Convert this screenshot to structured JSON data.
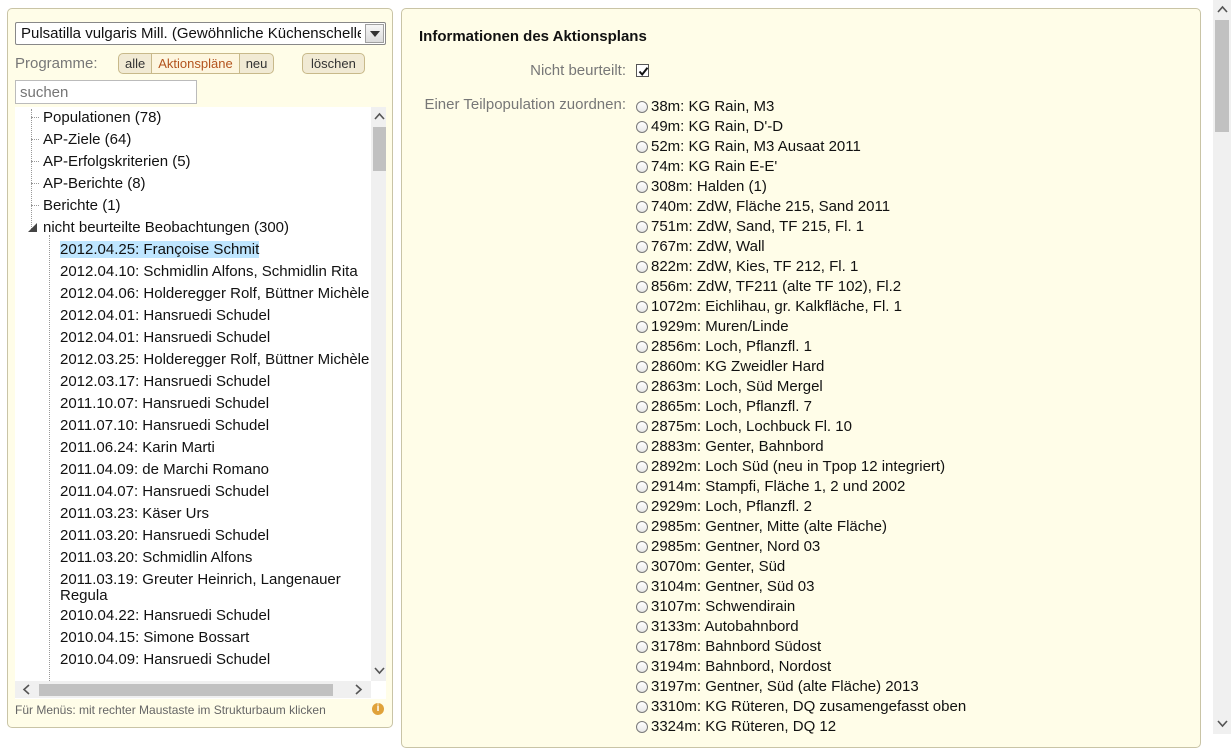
{
  "left": {
    "species_select": "Pulsatilla vulgaris Mill. (Gewöhnliche Küchenschelle)",
    "programme_label": "Programme:",
    "programme_buttons": [
      "alle",
      "Aktionspläne",
      "neu"
    ],
    "active_programme": "Aktionspläne",
    "delete_label": "löschen",
    "search_placeholder": "suchen",
    "tree": {
      "nodes": [
        "Populationen (78)",
        "AP-Ziele (64)",
        "AP-Erfolgskriterien (5)",
        "AP-Berichte (8)",
        "Berichte (1)",
        "nicht beurteilte Beobachtungen (300)"
      ],
      "observations": [
        "2012.04.25: Françoise Schmit",
        "2012.04.10: Schmidlin Alfons, Schmidlin Rita",
        "2012.04.06: Holderegger Rolf, Büttner Michèle",
        "2012.04.01: Hansruedi Schudel",
        "2012.04.01: Hansruedi Schudel",
        "2012.03.25: Holderegger Rolf, Büttner Michèle",
        "2012.03.17: Hansruedi Schudel",
        "2011.10.07: Hansruedi Schudel",
        "2011.07.10: Hansruedi Schudel",
        "2011.06.24: Karin Marti",
        "2011.04.09: de Marchi Romano",
        "2011.04.07: Hansruedi Schudel",
        "2011.03.23: Käser Urs",
        "2011.03.20: Hansruedi Schudel",
        "2011.03.20: Schmidlin Alfons",
        "2011.03.19: Greuter Heinrich, Langenauer Regula",
        "2010.04.22: Hansruedi Schudel",
        "2010.04.15: Simone Bossart",
        "2010.04.09: Hansruedi Schudel"
      ]
    },
    "footer_hint": "Für Menüs: mit rechter Maustaste im Strukturbaum klicken",
    "info_icon": "i"
  },
  "right": {
    "title": "Informationen des Aktionsplans",
    "not_assessed_label": "Nicht beurteilt:",
    "not_assessed_checked": true,
    "assign_label": "Einer Teilpopulation zuordnen:",
    "subpopulations": [
      "38m: KG Rain, M3",
      "49m: KG Rain, D'-D",
      "52m: KG Rain, M3 Ausaat 2011",
      "74m: KG Rain E-E'",
      "308m: Halden (1)",
      "740m: ZdW, Fläche 215, Sand 2011",
      "751m: ZdW, Sand, TF 215, Fl. 1",
      "767m: ZdW, Wall",
      "822m: ZdW, Kies, TF 212, Fl. 1",
      "856m: ZdW, TF211 (alte TF 102), Fl.2",
      "1072m: Eichlihau, gr. Kalkfläche, Fl. 1",
      "1929m: Muren/Linde",
      "2856m: Loch, Pflanzfl. 1",
      "2860m: KG Zweidler Hard",
      "2863m: Loch, Süd Mergel",
      "2865m: Loch, Pflanzfl. 7",
      "2875m: Loch, Lochbuck Fl. 10",
      "2883m: Genter, Bahnbord",
      "2892m: Loch Süd (neu in Tpop 12 integriert)",
      "2914m: Stampfi, Fläche 1, 2 und 2002",
      "2929m: Loch, Pflanzfl. 2",
      "2985m: Gentner, Mitte (alte Fläche)",
      "2985m: Gentner, Nord 03",
      "3070m: Genter, Süd",
      "3104m: Gentner, Süd 03",
      "3107m: Schwendirain",
      "3133m: Autobahnbord",
      "3178m: Bahnbord Südost",
      "3194m: Bahnbord, Nordost",
      "3197m: Gentner, Süd (alte Fläche) 2013",
      "3310m: KG Rüteren, DQ zusamengefasst oben",
      "3324m: KG Rüteren, DQ 12"
    ]
  },
  "colors": {
    "panel_bg": "#fffde8",
    "selected_bg": "#bfe6ff",
    "active_button_text": "#b3541e"
  }
}
